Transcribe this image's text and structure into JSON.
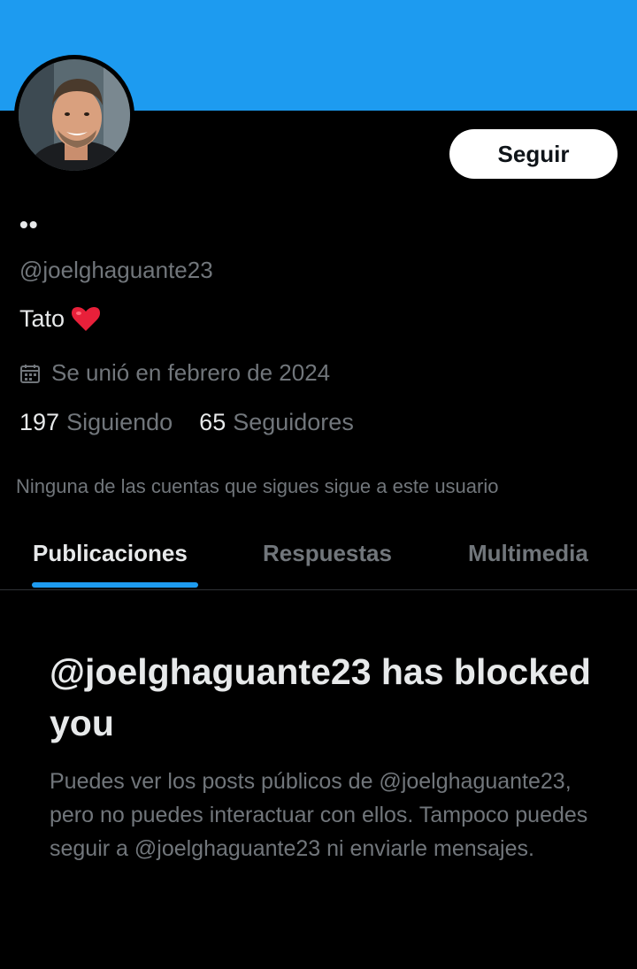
{
  "header": {
    "banner_color": "#1d9bf0"
  },
  "profile": {
    "avatar_icon": "profile-photo",
    "display_name": "••",
    "handle": "@joelghaguante23",
    "bio_text": "Tato",
    "bio_emoji": "red-heart-icon",
    "joined_icon": "calendar-icon",
    "joined_text": "Se unió en febrero de 2024",
    "following_count": "197",
    "following_label": "Siguiendo",
    "followers_count": "65",
    "followers_label": "Seguidores",
    "followers_note": "Ninguna de las cuentas que sigues sigue a este usuario"
  },
  "actions": {
    "follow_label": "Seguir"
  },
  "tabs": [
    {
      "label": "Publicaciones",
      "active": true
    },
    {
      "label": "Respuestas",
      "active": false
    },
    {
      "label": "Multimedia",
      "active": false
    }
  ],
  "blocked": {
    "title": "@joelghaguante23 has blocked you",
    "description": "Puedes ver los posts públicos de @joelghaguante23, pero no puedes interactuar con ellos. Tampoco puedes seguir a @joelghaguante23 ni enviarle mensajes."
  },
  "colors": {
    "accent": "#1d9bf0",
    "background": "#000000",
    "primary_text": "#e7e9ea",
    "secondary_text": "#71767b"
  }
}
